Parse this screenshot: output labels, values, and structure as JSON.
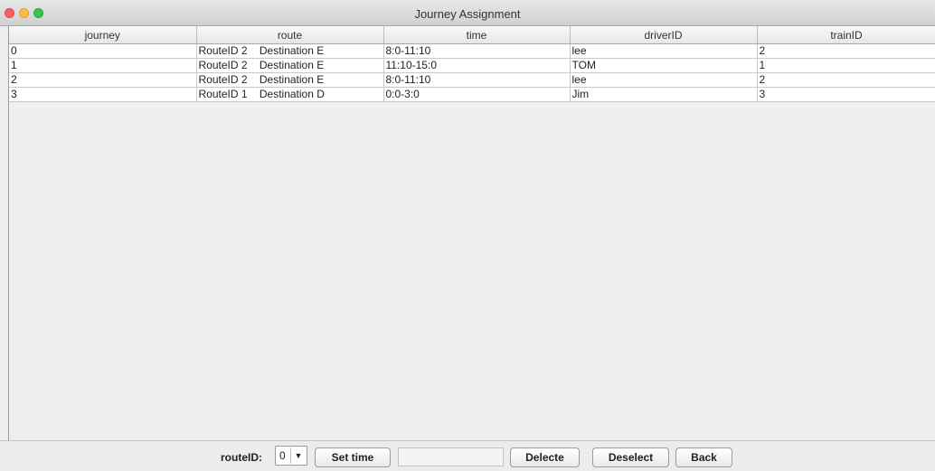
{
  "window": {
    "title": "Journey Assignment"
  },
  "table": {
    "columns": [
      "journey",
      "route",
      "time",
      "driverID",
      "trainID"
    ],
    "rows": [
      [
        "0",
        "RouteID 2    Destination E",
        "8:0-11:10",
        "lee",
        "2"
      ],
      [
        "1",
        "RouteID 2    Destination E",
        "11:10-15:0",
        "TOM",
        "1"
      ],
      [
        "2",
        "RouteID 2    Destination E",
        "8:0-11:10",
        "lee",
        "2"
      ],
      [
        "3",
        "RouteID 1    Destination D",
        "0:0-3:0",
        "Jim",
        "3"
      ]
    ]
  },
  "bottom": {
    "route_label": "routeID:",
    "route_value": "0",
    "set_time_label": "Set time",
    "time_field_value": "",
    "delete_label": "Delecte",
    "deselect_label": "Deselect",
    "back_label": "Back"
  },
  "colors": {
    "close": "#fc605c",
    "minimize": "#fdbc40",
    "maximize": "#34c84a"
  }
}
